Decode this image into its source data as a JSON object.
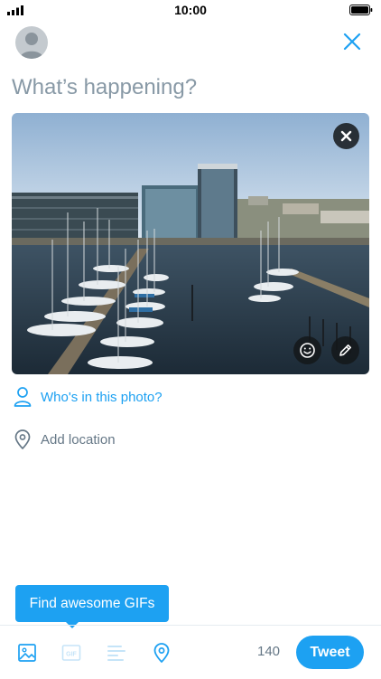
{
  "status_bar": {
    "time": "10:00"
  },
  "compose": {
    "placeholder": "What’s happening?"
  },
  "media": {
    "alt": "Harbor with moored sailboats and waterfront office buildings"
  },
  "actions": {
    "tag_people_label": "Who's in this photo?",
    "add_location_label": "Add location"
  },
  "tooltip": {
    "text": "Find awesome GIFs"
  },
  "toolbar": {
    "gif_label": "GIF",
    "char_count": "140",
    "tweet_label": "Tweet",
    "icons": [
      "image-icon",
      "gif-icon",
      "poll-icon",
      "location-icon"
    ]
  },
  "colors": {
    "accent": "#1da1f2",
    "placeholder": "#8899a6",
    "secondary_text": "#657786",
    "divider": "#e6ecf0"
  }
}
